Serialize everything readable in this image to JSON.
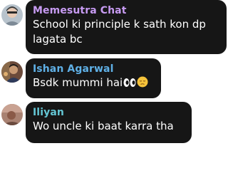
{
  "messages": [
    {
      "sender": "Memesutra Chat",
      "text_lines": [
        "School ki principle k sath kon dp",
        "lagata bc"
      ],
      "sender_color": "#c79bf2",
      "avatar": "profile-photo"
    },
    {
      "sender": "Ishan Agarwal",
      "text": "Bsdk mummi hai",
      "emojis": [
        "eyes",
        "pensive-face"
      ],
      "sender_color": "#5fb0e6",
      "avatar": "profile-photo"
    },
    {
      "sender": "Iliyan",
      "text": "Wo uncle ki baat karra tha",
      "sender_color": "#64c6d4",
      "avatar": "profile-photo"
    }
  ],
  "colors": {
    "bubble": "#161616",
    "text": "#ffffff",
    "background": "#ffffff"
  }
}
